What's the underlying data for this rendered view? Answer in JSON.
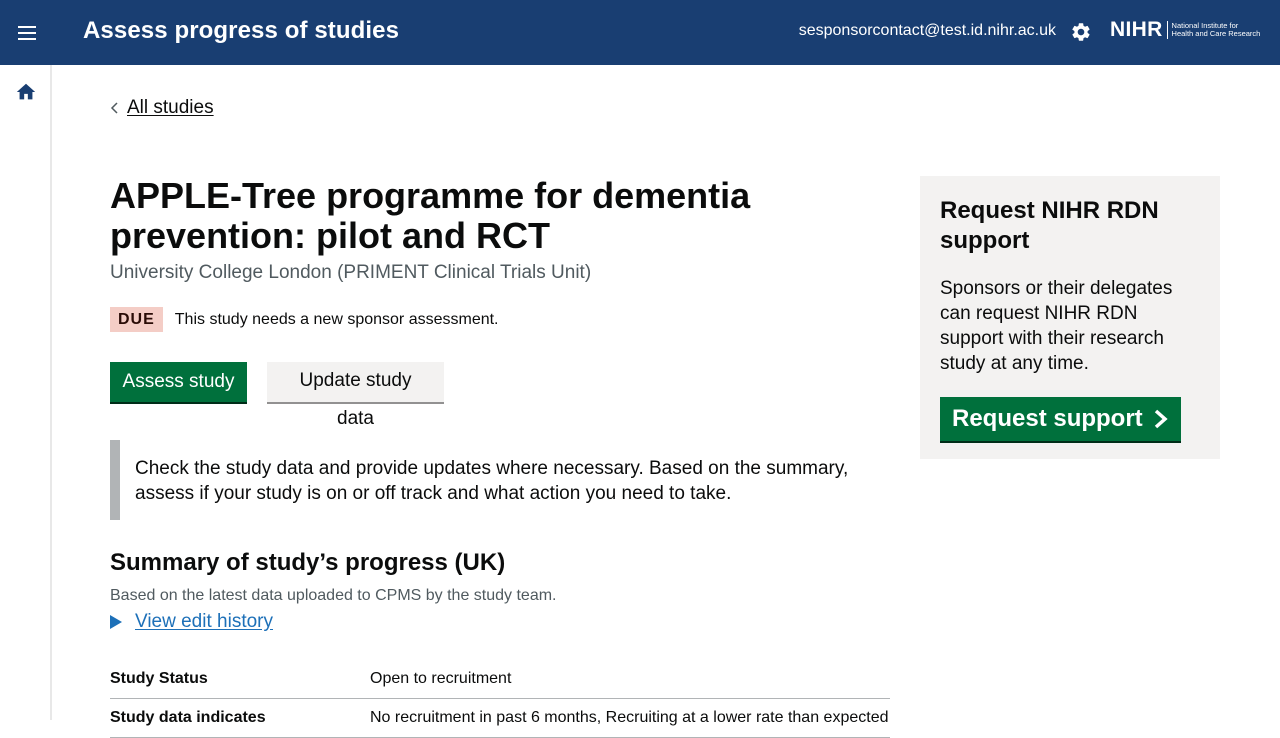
{
  "header": {
    "title": "Assess progress of studies",
    "email": "sesponsorcontact@test.id.nihr.ac.uk",
    "logo_mark": "NIHR",
    "logo_text_line1": "National Institute for",
    "logo_text_line2": "Health and Care Research",
    "menu_icon": "hamburger-menu-icon",
    "settings_icon": "gear-icon"
  },
  "rail": {
    "home_icon": "home-icon"
  },
  "nav": {
    "back_label": "All studies"
  },
  "study": {
    "title": "APPLE-Tree programme for dementia prevention: pilot and RCT",
    "organisation": "University College London (PRIMENT Clinical Trials Unit)",
    "status_badge": "DUE",
    "status_text": "This study needs a new sponsor assessment.",
    "assess_button": "Assess study",
    "update_button": "Update study data",
    "inset_text": "Check the study data and provide updates where necessary. Based on the summary, assess if your study is on or off track and what action you need to take."
  },
  "summary": {
    "title": "Summary of study’s progress (UK)",
    "subtitle": "Based on the latest data uploaded to CPMS by the study team.",
    "details_link": "View edit history",
    "rows": [
      {
        "key": "Study Status",
        "value": "Open to recruitment"
      },
      {
        "key": "Study data indicates",
        "value": "No recruitment in past 6 months, Recruiting at a lower rate than expected"
      }
    ]
  },
  "panel": {
    "title": "Request NIHR RDN support",
    "text": "Sponsors or their delegates can request NIHR RDN support with their research study at any time.",
    "button": "Request support"
  },
  "colors": {
    "header_bg": "#193e72",
    "primary_green": "#00703c",
    "link_blue": "#1d70b8",
    "badge_bg": "#f4cdc6",
    "panel_bg": "#f3f2f1"
  }
}
